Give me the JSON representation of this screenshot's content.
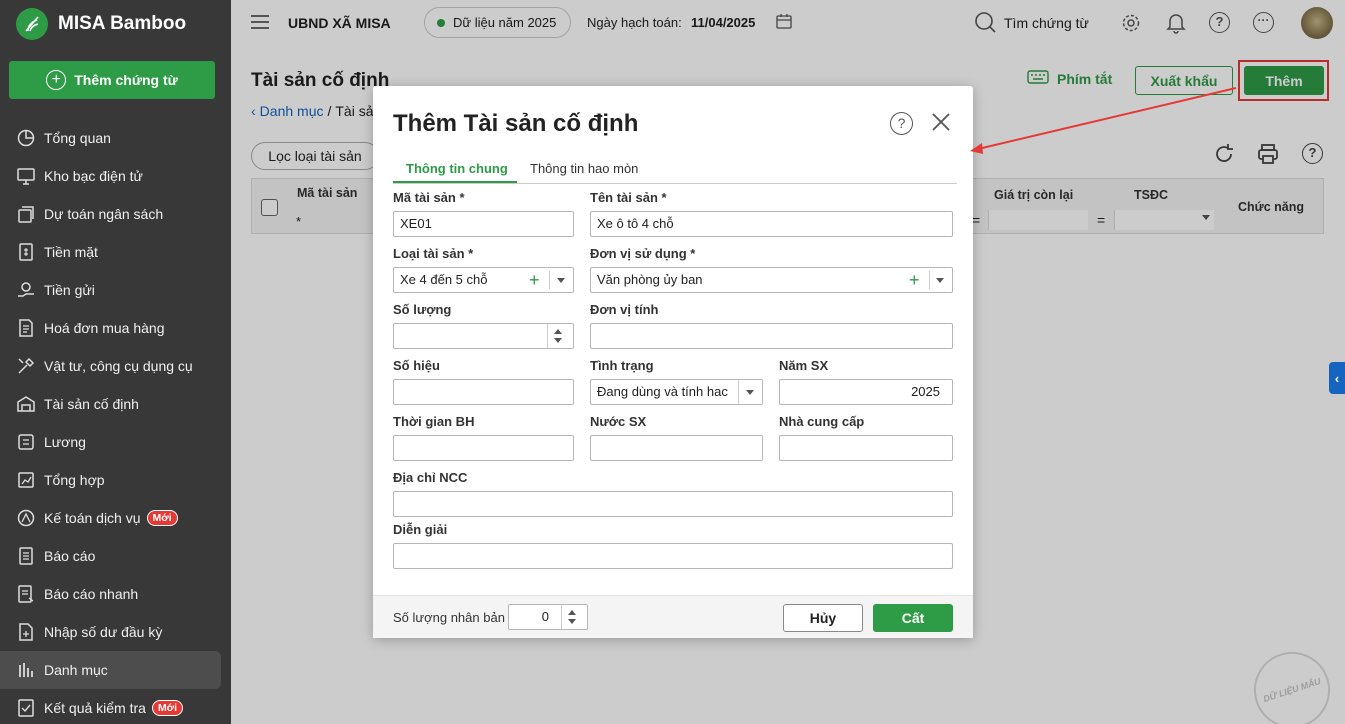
{
  "app": {
    "name": "MISA Bamboo",
    "new_voucher": "Thêm chứng từ"
  },
  "nav": [
    {
      "label": "Tổng quan",
      "icon": "pie-chart-icon"
    },
    {
      "label": "Kho bạc điện tử",
      "icon": "monitor-icon"
    },
    {
      "label": "Dự toán ngân sách",
      "icon": "budget-icon"
    },
    {
      "label": "Tiền mặt",
      "icon": "cash-icon"
    },
    {
      "label": "Tiền gửi",
      "icon": "deposit-icon"
    },
    {
      "label": "Hoá đơn mua hàng",
      "icon": "invoice-icon"
    },
    {
      "label": "Vật tư, công cụ dụng cụ",
      "icon": "tools-icon"
    },
    {
      "label": "Tài sản cố định",
      "icon": "building-icon"
    },
    {
      "label": "Lương",
      "icon": "salary-icon"
    },
    {
      "label": "Tổng hợp",
      "icon": "summary-icon"
    },
    {
      "label": "Kế toán dịch vụ",
      "icon": "service-icon",
      "badge": "Mới"
    },
    {
      "label": "Báo cáo",
      "icon": "report-icon"
    },
    {
      "label": "Báo cáo nhanh",
      "icon": "quick-report-icon"
    },
    {
      "label": "Nhập số dư đầu kỳ",
      "icon": "opening-balance-icon"
    },
    {
      "label": "Danh mục",
      "icon": "category-icon"
    },
    {
      "label": "Kết quả kiểm tra",
      "icon": "check-result-icon",
      "badge": "Mới"
    }
  ],
  "topbar": {
    "org": "UBND XÃ MISA",
    "data_year": "Dữ liệu năm 2025",
    "posting_label": "Ngày hạch toán:",
    "posting_date": "11/04/2025",
    "search": "Tìm chứng từ"
  },
  "page": {
    "title": "Tài sản cố định",
    "breadcrumb_root": "Danh mục",
    "breadcrumb_sep": "/",
    "breadcrumb_current": "Tài sả",
    "shortcut": "Phím tắt",
    "export": "Xuất khẩu",
    "add": "Thêm",
    "filter": "Lọc loại tài sản"
  },
  "grid": {
    "col_code": "Mã tài sản",
    "col_remaining": "Giá trị còn lại",
    "col_tsdc": "TSĐC",
    "col_func": "Chức năng",
    "filter_star": "*",
    "filter_eq": "="
  },
  "dialog": {
    "title": "Thêm Tài sản cố định",
    "tabs": [
      "Thông tin chung",
      "Thông tin hao mòn"
    ],
    "labels": {
      "code": "Mã tài sản *",
      "name": "Tên tài sản *",
      "type": "Loại tài sản *",
      "unit": "Đơn vị sử dụng *",
      "qty": "Số lượng",
      "uom": "Đơn vị tính",
      "serial": "Số hiệu",
      "status": "Tình trạng",
      "year": "Năm SX",
      "warranty": "Thời gian BH",
      "country": "Nước SX",
      "supplier": "Nhà cung cấp",
      "supplier_address": "Địa chỉ NCC",
      "description": "Diễn giải"
    },
    "values": {
      "code": "XE01",
      "name": "Xe ô tô 4 chỗ",
      "type": "Xe 4 đến 5 chỗ",
      "unit": "Văn phòng ủy ban",
      "qty": "",
      "uom": "",
      "serial": "",
      "status": "Đang dùng và tính hac",
      "year": "2025",
      "warranty": "",
      "country": "",
      "supplier": "",
      "supplier_address": "",
      "description": ""
    },
    "footer": {
      "dup_label": "Số lượng nhân bản",
      "dup_value": "0",
      "cancel": "Hủy",
      "save": "Cất"
    }
  },
  "watermark": "DỮ LIỆU MẪU",
  "colors": {
    "brand": "#2e9b46",
    "sidebar": "#383838",
    "highlight": "#e53935",
    "link": "#1565c0"
  }
}
